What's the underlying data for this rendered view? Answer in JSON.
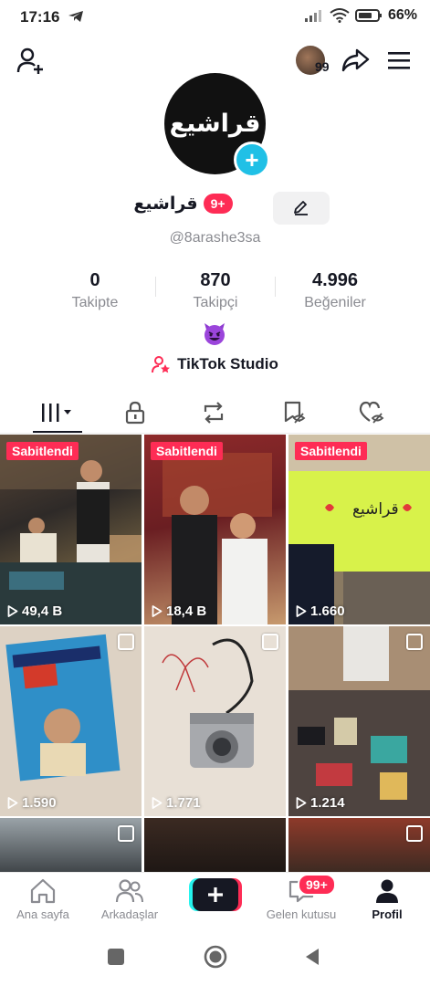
{
  "status_bar": {
    "time": "17:16",
    "battery": "66%"
  },
  "top_bar": {
    "viewers_count": "99"
  },
  "profile": {
    "avatar_text": "قراشيع",
    "display_name": "قراشيع",
    "name_badge": "9+",
    "username": "@8arashe3sa",
    "emoji": "😈",
    "studio_label": "TikTok Studio"
  },
  "stats": [
    {
      "value": "0",
      "label": "Takipte"
    },
    {
      "value": "870",
      "label": "Takipçi"
    },
    {
      "value": "4.996",
      "label": "Beğeniler"
    }
  ],
  "tabs": [
    "videos-grid",
    "private-lock",
    "reposts",
    "favorites",
    "liked"
  ],
  "grid": [
    {
      "pinned_label": "Sabitlendi",
      "views": "49,4 B",
      "sign_text": ""
    },
    {
      "pinned_label": "Sabitlendi",
      "views": "18,4 B",
      "sign_text": ""
    },
    {
      "pinned_label": "Sabitlendi",
      "views": "1.660",
      "sign_text": "قراشيع"
    },
    {
      "pinned_label": "",
      "views": "1.590",
      "sign_text": ""
    },
    {
      "pinned_label": "",
      "views": "1.771",
      "sign_text": ""
    },
    {
      "pinned_label": "",
      "views": "1.214",
      "sign_text": ""
    },
    {
      "pinned_label": "",
      "views": "",
      "sign_text": ""
    },
    {
      "pinned_label": "",
      "views": "",
      "sign_text": ""
    },
    {
      "pinned_label": "",
      "views": "",
      "sign_text": ""
    }
  ],
  "bottom_nav": {
    "home": "Ana sayfa",
    "friends": "Arkadaşlar",
    "inbox": "Gelen kutusu",
    "inbox_badge": "99+",
    "profile": "Profil"
  },
  "colors": {
    "accent": "#fe2c55",
    "teal": "#20c0e6",
    "text": "#161823",
    "muted": "#8a8b91"
  }
}
